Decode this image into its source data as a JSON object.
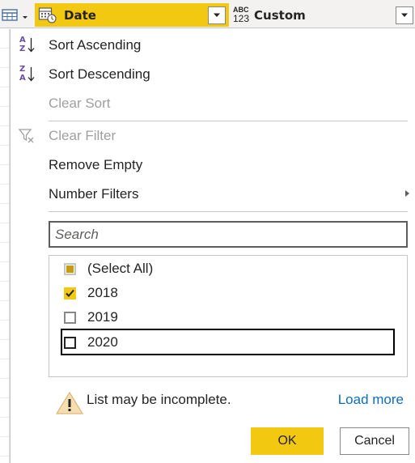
{
  "header": {
    "date_column": {
      "title": "Date",
      "type_icon": "calendar-clock-icon"
    },
    "custom_column": {
      "title": "Custom",
      "type_badge_top": "ABC",
      "type_badge_bottom": "123"
    }
  },
  "menu": {
    "sort_ascending": {
      "label": "Sort Ascending",
      "icon_top": "A",
      "icon_bottom": "Z"
    },
    "sort_descending": {
      "label": "Sort Descending",
      "icon_top": "Z",
      "icon_bottom": "A"
    },
    "clear_sort": {
      "label": "Clear Sort"
    },
    "clear_filter": {
      "label": "Clear Filter"
    },
    "remove_empty": {
      "label": "Remove Empty"
    },
    "number_filters": {
      "label": "Number Filters"
    }
  },
  "search": {
    "placeholder": "Search",
    "value": ""
  },
  "values_list": [
    {
      "label": "(Select All)",
      "state": "partial"
    },
    {
      "label": "2018",
      "state": "checked"
    },
    {
      "label": "2019",
      "state": "unchecked"
    },
    {
      "label": "2020",
      "state": "unchecked"
    }
  ],
  "footer": {
    "warning_text": "List may be incomplete.",
    "load_more_label": "Load more",
    "ok_label": "OK",
    "cancel_label": "Cancel"
  },
  "colors": {
    "accent": "#f2c811",
    "header_bg": "#f3f2f1",
    "link": "#0f6cbd",
    "disabled_text": "#a19f9d",
    "warning": "#e3c07a"
  }
}
